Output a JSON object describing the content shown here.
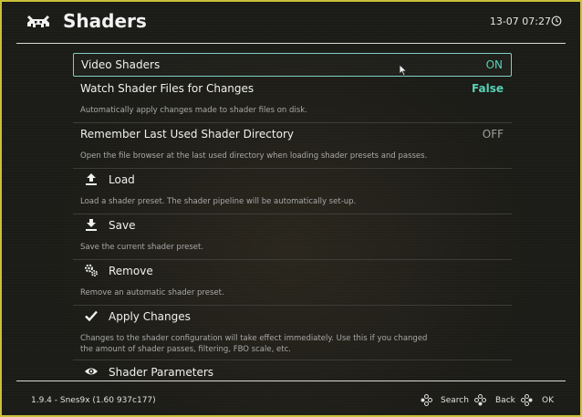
{
  "header": {
    "title": "Shaders",
    "clock": "13-07 07:27"
  },
  "menu": {
    "items": [
      {
        "label": "Video Shaders",
        "value": "ON",
        "value_color": "#57d2b5"
      },
      {
        "label": "Watch Shader Files for Changes",
        "value": "False",
        "value_color": "#57d2b5",
        "description": "Automatically apply changes made to shader files on disk."
      },
      {
        "label": "Remember Last Used Shader Directory",
        "value": "OFF",
        "value_color": "#a0a0a0",
        "description": "Open the file browser at the last used directory when loading shader presets and passes."
      },
      {
        "label": "Load",
        "icon": "upload-icon",
        "description": "Load a shader preset. The shader pipeline will be automatically set-up."
      },
      {
        "label": "Save",
        "icon": "download-icon",
        "description": "Save the current shader preset."
      },
      {
        "label": "Remove",
        "icon": "gears-icon",
        "description": "Remove an automatic shader preset."
      },
      {
        "label": "Apply Changes",
        "icon": "checkmark-icon",
        "description_line1": "Changes to the shader configuration will take effect immediately. Use this if you changed",
        "description_line2": "the amount of shader passes, filtering, FBO scale, etc."
      },
      {
        "label": "Shader Parameters",
        "icon": "eye-icon"
      }
    ]
  },
  "footer": {
    "version": "1.9.4 - Snes9x (1.60 937c177)",
    "search_label": "Search",
    "back_label": "Back",
    "ok_label": "OK"
  }
}
